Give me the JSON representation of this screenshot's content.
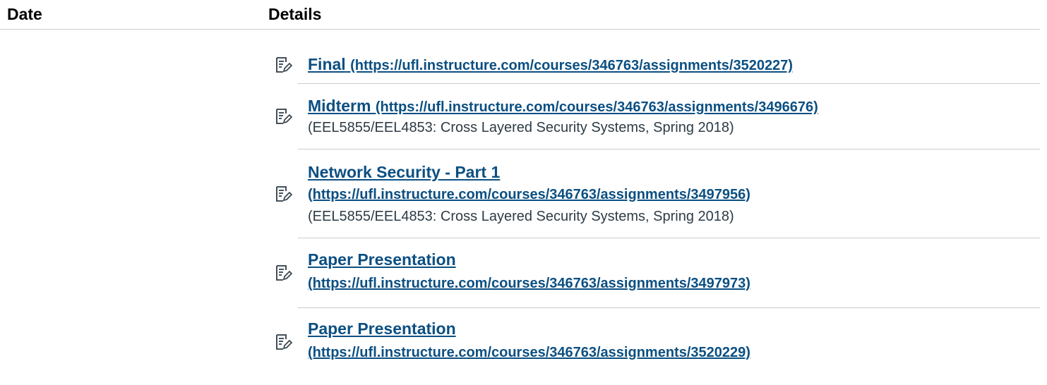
{
  "header": {
    "date_label": "Date",
    "details_label": "Details"
  },
  "items": [
    {
      "title": "Final",
      "url": "(https://ufl.instructure.com/courses/346763/assignments/3520227)",
      "course": ""
    },
    {
      "title": "Midterm",
      "url": "(https://ufl.instructure.com/courses/346763/assignments/3496676)",
      "course": "(EEL5855/EEL4853: Cross Layered Security Systems, Spring 2018)"
    },
    {
      "title": "Network Security - Part 1",
      "url": "(https://ufl.instructure.com/courses/346763/assignments/3497956)",
      "course": "(EEL5855/EEL4853: Cross Layered Security Systems, Spring 2018)"
    },
    {
      "title": "Paper Presentation",
      "url": "(https://ufl.instructure.com/courses/346763/assignments/3497973)",
      "course": ""
    },
    {
      "title": "Paper Presentation",
      "url": "(https://ufl.instructure.com/courses/346763/assignments/3520229)",
      "course": ""
    }
  ],
  "icon": "assignment-icon",
  "colors": {
    "link": "#0b4f82",
    "text": "#2d3b45",
    "divider": "#c7cdd1"
  }
}
